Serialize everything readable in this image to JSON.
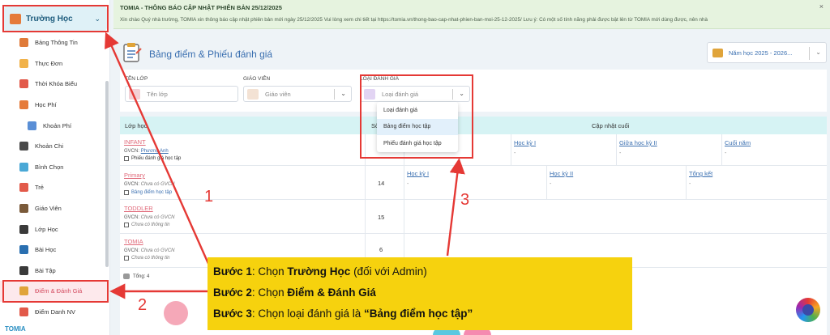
{
  "sidebar": {
    "school_label": "Trường Học",
    "items": [
      {
        "label": "Bảng Thông Tin",
        "icon": "board-icon",
        "color": "#e07b39"
      },
      {
        "label": "Thực Đơn",
        "icon": "menu-icon",
        "color": "#f1b24a"
      },
      {
        "label": "Thời Khóa Biểu",
        "icon": "calendar-icon",
        "color": "#e25a4a"
      },
      {
        "label": "Học Phí",
        "icon": "fee-icon",
        "color": "#e57b3a"
      },
      {
        "label": "Khoản Phí",
        "icon": "fee-item-icon",
        "color": "#5a8fd6"
      },
      {
        "label": "Khoản Chi",
        "icon": "expense-icon",
        "color": "#4a4a4a"
      },
      {
        "label": "Bình Chọn",
        "icon": "vote-icon",
        "color": "#4aa8d6"
      },
      {
        "label": "Trẻ",
        "icon": "child-icon",
        "color": "#e25a4a"
      },
      {
        "label": "Giáo Viên",
        "icon": "teacher-icon",
        "color": "#7a5a3a"
      },
      {
        "label": "Lớp Học",
        "icon": "class-icon",
        "color": "#3a3a3a"
      },
      {
        "label": "Bài Học",
        "icon": "lesson-icon",
        "color": "#2a6fb0"
      },
      {
        "label": "Bài Tập",
        "icon": "exercise-icon",
        "color": "#3a3a3a"
      },
      {
        "label": "Điểm & Đánh Giá",
        "icon": "grade-icon",
        "color": "#e0a43a"
      },
      {
        "label": "Điểm Danh NV",
        "icon": "attendance-icon",
        "color": "#e25a4a"
      }
    ],
    "logo": "TOMIA"
  },
  "notice": {
    "title": "TOMIA - THÔNG BÁO CẬP NHẬT PHIÊN BẢN 25/12/2025",
    "message": "Xin chào Quý nhà trường, TOMIA xin thông báo cập nhật phiên bản mới ngày 25/12/2025 Vui lòng xem chi tiết tại https://tomia.vn/thong-bao-cap-nhat-phien-ban-moi-25-12-2025/ Lưu ý: Có một số tính năng phải được bật lên từ TOMIA mới dùng được, nên nhà",
    "close": "×"
  },
  "page": {
    "title": "Bảng điểm & Phiếu đánh giá",
    "year": "Năm học 2025 - 2026..."
  },
  "filters": {
    "class_label": "TÊN LỚP",
    "class_placeholder": "Tên lớp",
    "teacher_label": "GIÁO VIÊN",
    "teacher_placeholder": "Giáo viên",
    "type_label": "LOẠI ĐÁNH GIÁ",
    "type_placeholder": "Loại đánh giá",
    "options": [
      "Loại đánh giá",
      "Bảng điểm học tập",
      "Phiếu đánh giá học tập"
    ]
  },
  "table": {
    "col_class": "Lớp học",
    "col_count": "Số",
    "col_updated": "Cập nhật cuối",
    "rows": [
      {
        "name": "INFANT",
        "gvcn_label": "GVCN:",
        "gvcn": "Phương Anh",
        "type": "Phiếu đánh giá học tập",
        "count": "14",
        "sems": [
          "Học kỳ I",
          "Học kỳ I",
          "Giữa học kỳ II",
          "Cuối năm"
        ]
      },
      {
        "name": "Primary",
        "gvcn_label": "GVCN:",
        "gvcn": "Chưa có GVCN",
        "type": "Bảng điểm học tập",
        "count": "14",
        "sems": [
          "Học kỳ I",
          "Học kỳ II",
          "Tổng kết"
        ]
      },
      {
        "name": "TODDLER",
        "gvcn_label": "GVCN:",
        "gvcn": "Chưa có GVCN",
        "type": "Chưa có thông tin",
        "count": "15"
      },
      {
        "name": "TOMIA",
        "gvcn_label": "GVCN:",
        "gvcn": "Chưa có GVCN",
        "type": "Chưa có thông tin",
        "count": "6"
      }
    ],
    "dash": "-",
    "total": "Tổng: 4"
  },
  "annotation": {
    "step1_prefix": "Bước 1",
    "step1_text": ": Chọn ",
    "step1_bold": "Trường Học",
    "step1_suffix": " (đối với Admin)",
    "step2_prefix": "Bước 2",
    "step2_text": ": Chọn ",
    "step2_bold": "Điểm & Đánh Giá",
    "step3_prefix": "Bước 3",
    "step3_text": ": Chọn loại đánh giá là ",
    "step3_bold": "“Bảng điểm học tập”",
    "n1": "1",
    "n2": "2",
    "n3": "3"
  },
  "colors": {
    "accent": "#3a6fb0",
    "annotation_red": "#e53935",
    "callout_yellow": "#f6d20e"
  }
}
